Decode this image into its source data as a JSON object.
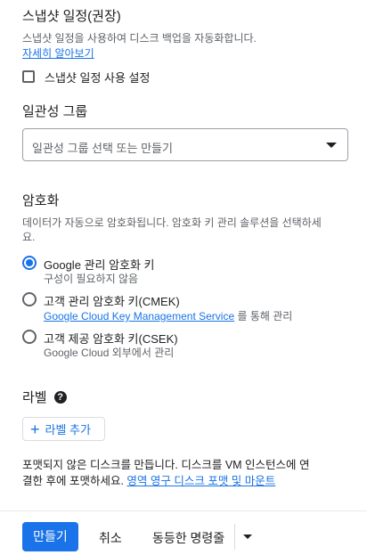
{
  "snapshot": {
    "title": "스냅샷 일정(권장)",
    "description": "스냅샷 일정을 사용하여 디스크 백업을 자동화합니다.",
    "learn_more": "자세히 알아보기",
    "checkbox_label": "스냅샷 일정 사용 설정"
  },
  "consistency": {
    "title": "일관성 그룹",
    "select_placeholder": "일관성 그룹 선택 또는 만들기"
  },
  "encryption": {
    "title": "암호화",
    "description_line1": "데이터가 자동으로 암호화됩니다. 암호화 키 관리 솔루션을 선택하세",
    "description_line2": "요.",
    "options": [
      {
        "label": "Google 관리 암호화 키",
        "sub": "구성이 필요하지 않음",
        "selected": true
      },
      {
        "label": "고객 관리 암호화 키(CMEK)",
        "sub_link": "Google Cloud Key Management Service",
        "sub_suffix": " 를 통해 관리",
        "selected": false
      },
      {
        "label": "고객 제공 암호화 키(CSEK)",
        "sub": "Google Cloud 외부에서 관리",
        "selected": false
      }
    ]
  },
  "labels": {
    "title": "라벨",
    "add_label": "라벨 추가"
  },
  "note": {
    "line1": "포맷되지 않은 디스크를 만듭니다. 디스크를 VM 인스턴스에 연",
    "line2_prefix": "결한 후에 포맷하세요. ",
    "line2_link": "영역 영구 디스크 포맷 및 마운트"
  },
  "footer": {
    "create": "만들기",
    "cancel": "취소",
    "equivalent": "동등한 명령줄"
  },
  "colors": {
    "accent": "#1a73e8",
    "text": "#202124",
    "secondary": "#5f6368"
  }
}
